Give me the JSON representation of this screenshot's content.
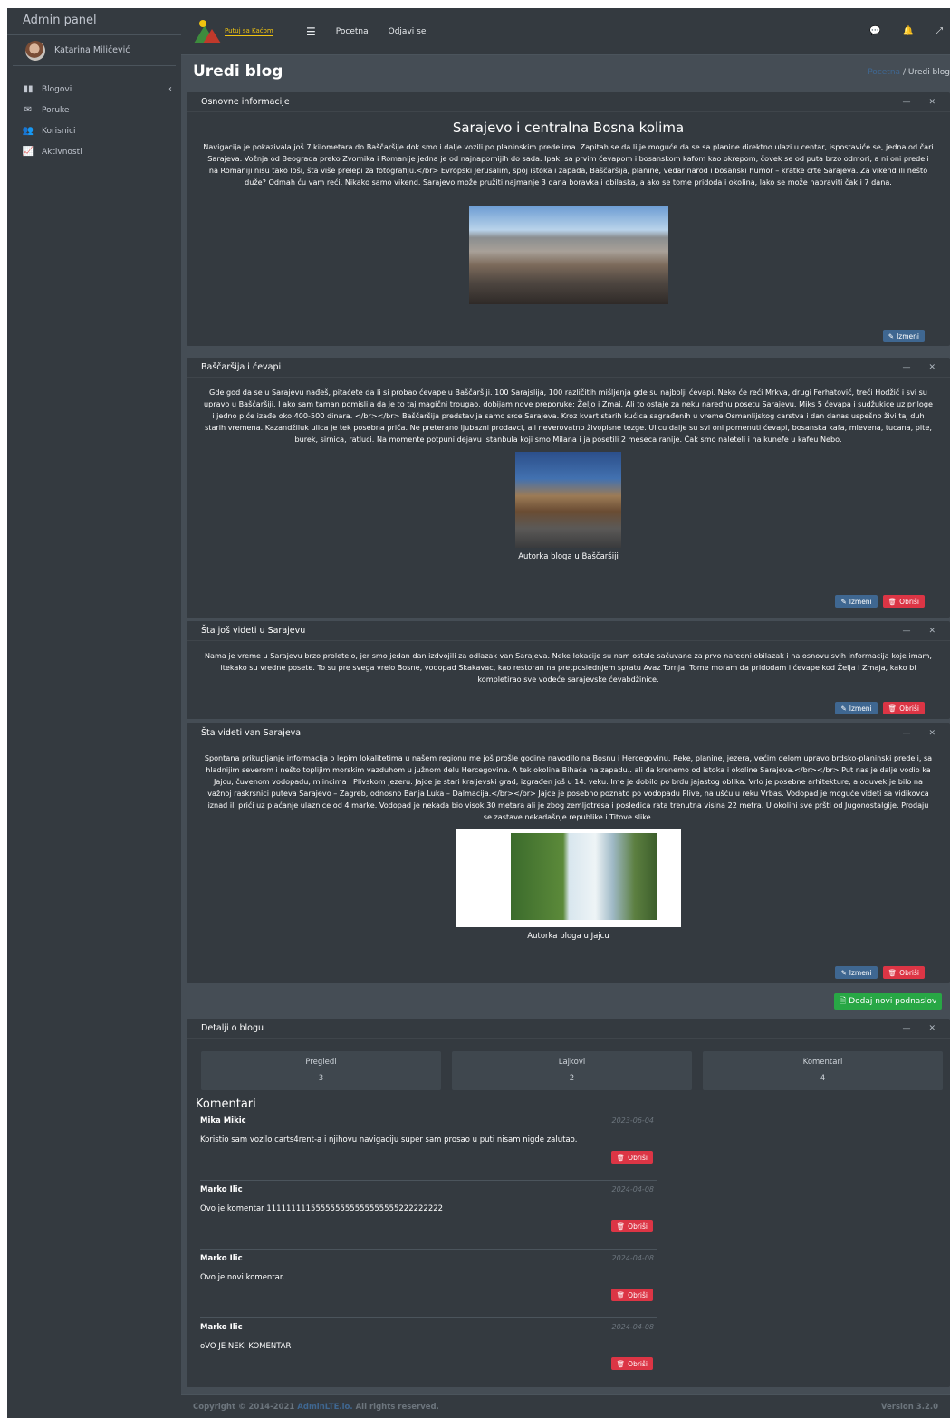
{
  "sidebar": {
    "brand": "Admin panel",
    "user_name": "Katarina Milićević",
    "items": [
      {
        "label": "Blogovi",
        "icon": "books-icon"
      },
      {
        "label": "Poruke",
        "icon": "envelope-icon"
      },
      {
        "label": "Korisnici",
        "icon": "users-icon"
      },
      {
        "label": "Aktivnosti",
        "icon": "chart-line-icon"
      }
    ]
  },
  "navbar": {
    "logo_text": "Putuj sa Kaćom",
    "links": [
      "Pocetna",
      "Odjavi se"
    ]
  },
  "page": {
    "title": "Uredi blog",
    "breadcrumb_home": "Pocetna",
    "breadcrumb_sep": "/",
    "breadcrumb_current": "Uredi blog"
  },
  "cards": [
    {
      "header": "Osnovne informacije",
      "title": "Sarajevo i centralna Bosna kolima",
      "text": "Navigacija je pokazivala još 7 kilometara do Baščaršije dok smo i dalje vozili po planinskim predelima. Zapitah se da li je moguće da se sa planine direktno ulazi u centar, ispostaviće se, jedna od čari Sarajeva. Vožnja od Beograda preko Zvornika i Romanije jedna je od najnapornijih do sada. Ipak, sa prvim ćevapom i bosanskom kafom kao okrepom, čovek se od puta brzo odmori, a ni oni predeli na Romaniji nisu tako loši, šta više prelepi za fotografiju.</br> Evropski Jerusalim, spoj istoka i zapada, Baščaršija, planine, vedar narod i bosanski humor – kratke crte Sarajeva. Za vikend ili nešto duže? Odmah ću vam reći. Nikako samo vikend. Sarajevo može pružiti najmanje 3 dana boravka i obilaska, a ako se tome pridoda i okolina, lako se može napraviti čak i 7 dana.",
      "edit_label": "Izmeni"
    },
    {
      "header": "Baščaršija i ćevapi",
      "text": "Gde god da se u Sarajevu nađeš, pitaćete da li si probao ćevape u Baščaršiji. 100 Sarajslija, 100 različitih mišljenja gde su najbolji ćevapi. Neko će reći Mrkva, drugi Ferhatović, treći Hodžić i svi su upravo u Baščaršiji. I ako sam taman pomislila da je to taj magični trougao, dobijam nove preporuke: Željo i Zmaj. Ali to ostaje za neku narednu posetu Sarajevu. Miks 5 ćevapa i sudžukice uz priloge i jedno piće izađe oko 400-500 dinara. </br></br> Baščaršija predstavlja samo srce Sarajeva. Kroz kvart starih kućica sagrađenih u vreme Osmanlijskog carstva i dan danas uspešno živi taj duh starih vremena. Kazandžiluk ulica je tek posebna priča. Ne preterano ljubazni prodavci, ali neverovatno živopisne tezge. Ulicu dalje su svi oni pomenuti ćevapi, bosanska kafa, mlevena, tucana, pite, burek, sirnica, ratluci. Na momente potpuni dejavu Istanbula koji smo Milana i ja posetili 2 meseca ranije. Čak smo naleteli i na kunefe u kafeu Nebo.",
      "caption": "Autorka bloga u Baščaršiji",
      "edit_label": "Izmeni",
      "delete_label": "Obriši"
    },
    {
      "header": "Šta još videti u Sarajevu",
      "text": "Nama je vreme u Sarajevu brzo proletelo, jer smo jedan dan izdvojili za odlazak van Sarajeva. Neke lokacije su nam ostale sačuvane za prvo naredni obilazak i na osnovu svih informacija koje imam, itekako su vredne posete. To su pre svega vrelo Bosne, vodopad Skakavac, kao restoran na pretposlednjem spratu Avaz Tornja. Tome moram da pridodam i ćevape kod Željа i Zmaja, kako bi kompletirao sve vodeće sarajevske ćevabdžinice.",
      "edit_label": "Izmeni",
      "delete_label": "Obriši"
    },
    {
      "header": "Šta videti van Sarajeva",
      "text": "Spontana prikupljanje informacija o lepim lokalitetima u našem regionu me još prošle godine navodilo na Bosnu i Hercegovinu. Reke, planine, jezera, većim delom upravo brdsko-planinski predeli, sa hladnijim severom i nešto toplijim morskim vazduhom u južnom delu Hercegovine. A tek okolina Bihaća na zapadu.. ali da krenemo od istoka i okoline Sarajeva.</br></br> Put nas je dalje vodio ka Jajcu, čuvenom vodopadu, mlincima i Plivskom jezeru. Jajce je stari kraljevski grad, izgrađen još u 14. veku. Ime je dobilo po brdu jajastog oblika. Vrlo je posebne arhitekture, a oduvek je bilo na važnoj raskrsnici puteva Sarajevo – Zagreb, odnosno Banja Luka – Dalmacija.</br></br> Jajce je posebno poznato po vodopadu Plive, na ušću u reku Vrbas. Vodopad je moguće videti sa vidikovca iznad ili prići uz plaćanje ulaznice od 4 marke. Vodopad je nekada bio visok 30 metara ali je zbog zemljotresa i posledica rata trenutna visina 22 metra. U okolini sve pršti od Jugonostalgije. Prodaju se zastave nekadašnje republike i Titove slike.",
      "caption": "Autorka bloga u Jajcu",
      "edit_label": "Izmeni",
      "delete_label": "Obriši"
    }
  ],
  "add_subtitle_label": "Dodaj novi podnaslov",
  "details": {
    "header": "Detalji o blogu",
    "stats": [
      {
        "label": "Pregledi",
        "value": "3"
      },
      {
        "label": "Lajkovi",
        "value": "2"
      },
      {
        "label": "Komentari",
        "value": "4"
      }
    ],
    "comments_title": "Komentari",
    "comments": [
      {
        "name": "Mika Mikic",
        "date": "2023-06-04",
        "text": "Koristio sam vozilo carts4rent-a i njihovu navigaciju super sam prosao u puti nisam nigde zalutao."
      },
      {
        "name": "Marko Ilic",
        "date": "2024-04-08",
        "text": "Ovo je komentar 111111111555555555555555555222222222"
      },
      {
        "name": "Marko Ilic",
        "date": "2024-04-08",
        "text": "Ovo je novi komentar."
      },
      {
        "name": "Marko Ilic",
        "date": "2024-04-08",
        "text": "oVO JE NEKI KOMENTAR"
      }
    ],
    "delete_label": "Obriši"
  },
  "footer": {
    "copyright": "Copyright © 2014-2021",
    "link": "AdminLTE.io.",
    "rights": "All rights reserved.",
    "version": "Version 3.2.0"
  }
}
